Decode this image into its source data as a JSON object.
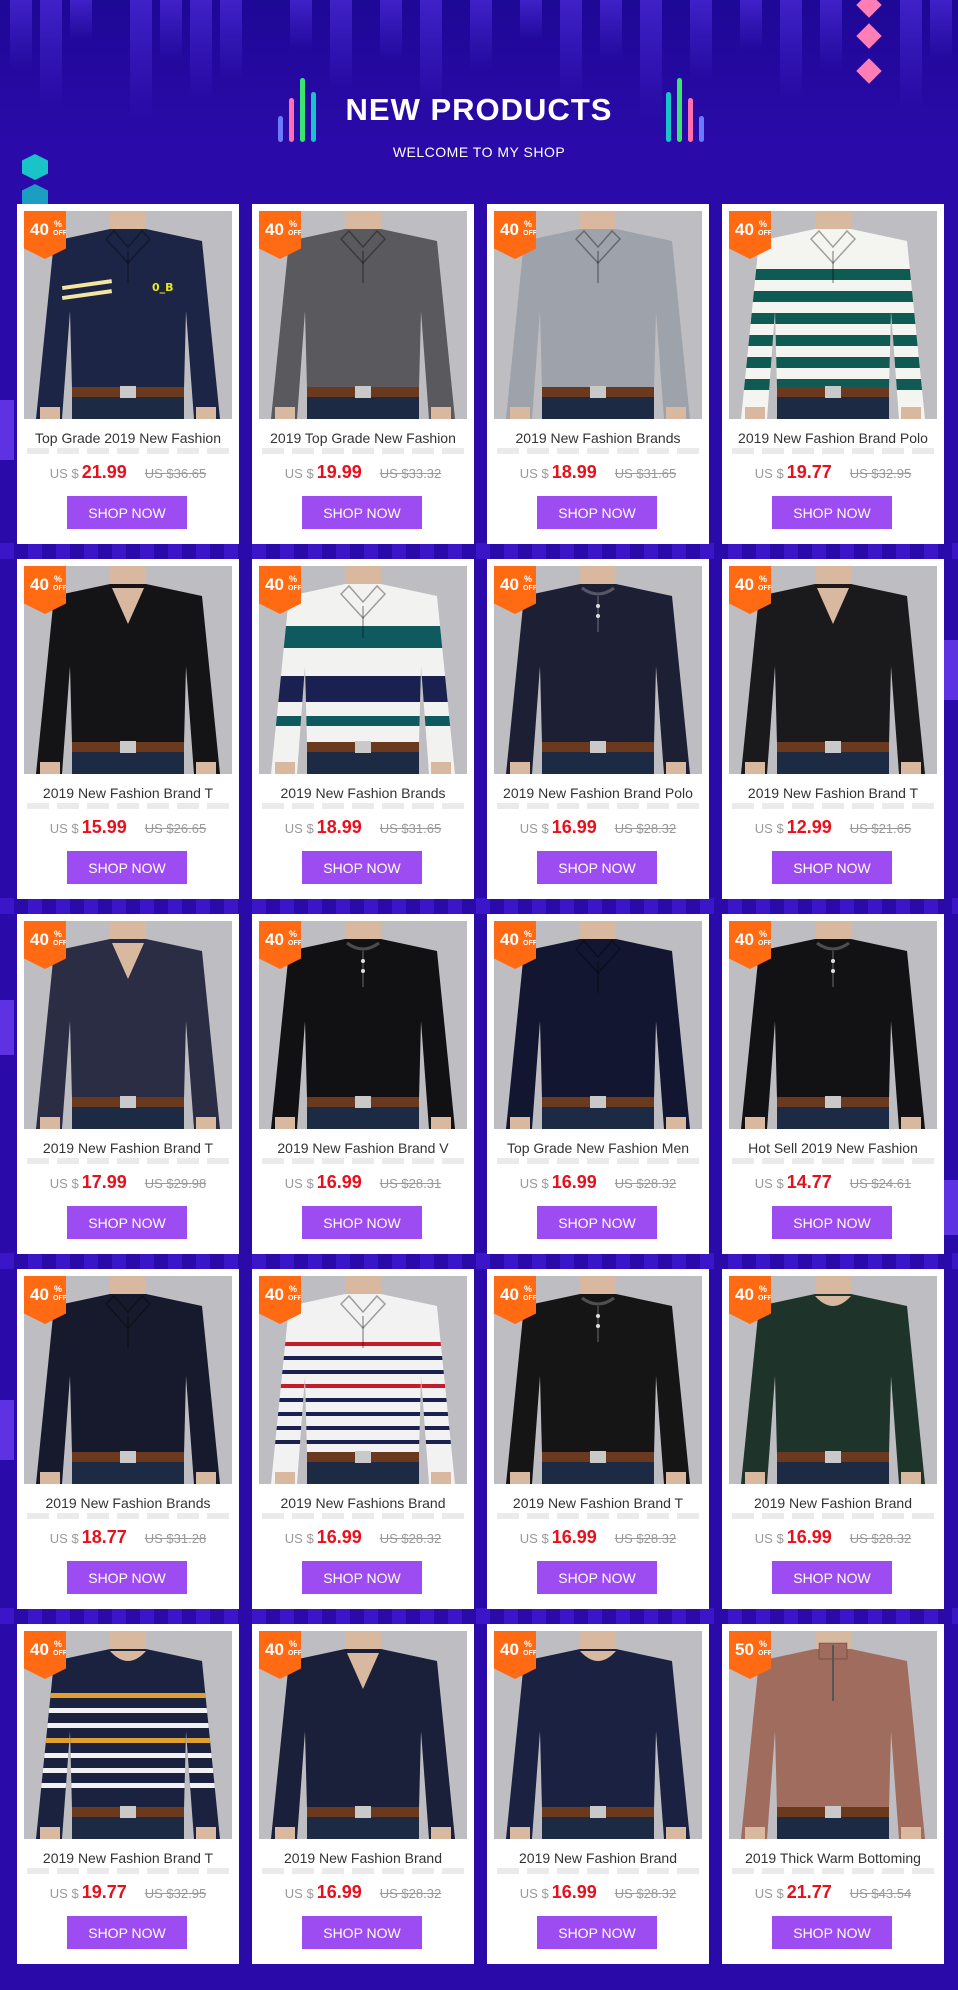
{
  "header": {
    "title": "NEW PRODUCTS",
    "subtitle": "WELCOME TO MY SHOP"
  },
  "colors": {
    "background": "#2a0aa8",
    "button": "#9d4cf2",
    "badge": "#ff6a13",
    "price": "#e8101c"
  },
  "button_label": "SHOP NOW",
  "currency_label": "US $",
  "products": [
    {
      "title": "Top Grade 2019 New Fashion",
      "price": "21.99",
      "old_price": "US $36.65",
      "discount": "40",
      "shirt": "#1c2545",
      "accent": "stripe-chest",
      "collar": "polo"
    },
    {
      "title": "2019 Top Grade New Fashion",
      "price": "19.99",
      "old_price": "US $33.32",
      "discount": "40",
      "shirt": "#5a5a5e",
      "accent": "none",
      "collar": "polo"
    },
    {
      "title": "2019 New Fashion Brands",
      "price": "18.99",
      "old_price": "US $31.65",
      "discount": "40",
      "shirt": "#9ea2ab",
      "accent": "none",
      "collar": "polo"
    },
    {
      "title": "2019 New Fashion Brand Polo",
      "price": "19.77",
      "old_price": "US $32.95",
      "discount": "40",
      "shirt": "#f4f4f0",
      "accent": "green-stripes",
      "collar": "polo"
    },
    {
      "title": "2019 New Fashion Brand T",
      "price": "15.99",
      "old_price": "US $26.65",
      "discount": "40",
      "shirt": "#141416",
      "accent": "none",
      "collar": "v"
    },
    {
      "title": "2019 New Fashion Brands",
      "price": "18.99",
      "old_price": "US $31.65",
      "discount": "40",
      "shirt": "#f2f2f0",
      "accent": "wide-stripes",
      "collar": "polo"
    },
    {
      "title": "2019 New Fashion Brand Polo",
      "price": "16.99",
      "old_price": "US $28.32",
      "discount": "40",
      "shirt": "#1d1f34",
      "accent": "none",
      "collar": "henley"
    },
    {
      "title": "2019 New Fashion Brand T",
      "price": "12.99",
      "old_price": "US $21.65",
      "discount": "40",
      "shirt": "#1a1a1c",
      "accent": "none",
      "collar": "v"
    },
    {
      "title": "2019 New Fashion Brand T",
      "price": "17.99",
      "old_price": "US $29.98",
      "discount": "40",
      "shirt": "#2b2d45",
      "accent": "none",
      "collar": "v"
    },
    {
      "title": "2019 New Fashion Brand V",
      "price": "16.99",
      "old_price": "US $28.31",
      "discount": "40",
      "shirt": "#111113",
      "accent": "none",
      "collar": "henley"
    },
    {
      "title": "Top Grade New Fashion Men",
      "price": "16.99",
      "old_price": "US $28.32",
      "discount": "40",
      "shirt": "#131631",
      "accent": "none",
      "collar": "polo"
    },
    {
      "title": "Hot Sell 2019 New Fashion",
      "price": "14.77",
      "old_price": "US $24.61",
      "discount": "40",
      "shirt": "#121214",
      "accent": "none",
      "collar": "henley"
    },
    {
      "title": "2019 New Fashion Brands",
      "price": "18.77",
      "old_price": "US $31.28",
      "discount": "40",
      "shirt": "#171a2c",
      "accent": "none",
      "collar": "polo"
    },
    {
      "title": "2019 New Fashions Brand",
      "price": "16.99",
      "old_price": "US $28.32",
      "discount": "40",
      "shirt": "#f2f2f2",
      "accent": "red-stripes",
      "collar": "polo"
    },
    {
      "title": "2019 New Fashion Brand T",
      "price": "16.99",
      "old_price": "US $28.32",
      "discount": "40",
      "shirt": "#151515",
      "accent": "none",
      "collar": "henley"
    },
    {
      "title": "2019 New Fashion Brand",
      "price": "16.99",
      "old_price": "US $28.32",
      "discount": "40",
      "shirt": "#1e3329",
      "accent": "none",
      "collar": "round"
    },
    {
      "title": "2019 New Fashion Brand T",
      "price": "19.77",
      "old_price": "US $32.95",
      "discount": "40",
      "shirt": "#1a2240",
      "accent": "gold-stripes",
      "collar": "round"
    },
    {
      "title": "2019 New Fashion Brand",
      "price": "16.99",
      "old_price": "US $28.32",
      "discount": "40",
      "shirt": "#1a1f3a",
      "accent": "none",
      "collar": "v"
    },
    {
      "title": "2019 New Fashion Brand",
      "price": "16.99",
      "old_price": "US $28.32",
      "discount": "40",
      "shirt": "#1b2140",
      "accent": "none",
      "collar": "round"
    },
    {
      "title": "2019 Thick Warm Bottoming",
      "price": "21.77",
      "old_price": "US $43.54",
      "discount": "50",
      "shirt": "#a06c5e",
      "accent": "none",
      "collar": "zip"
    }
  ]
}
